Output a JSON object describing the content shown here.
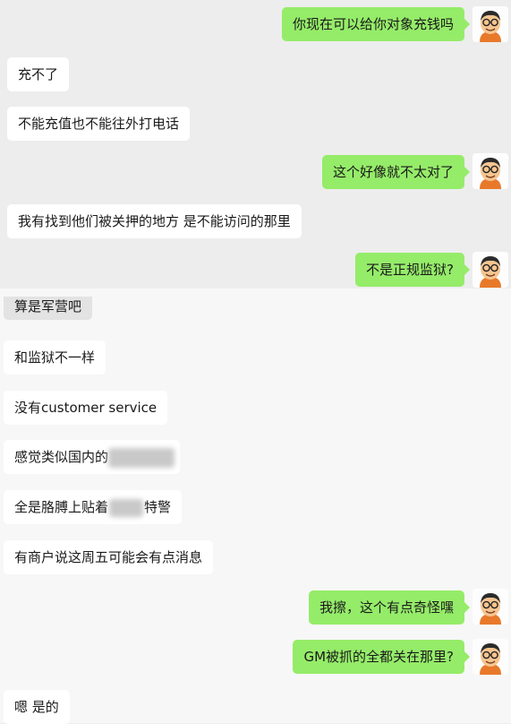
{
  "chat": {
    "messages": [
      {
        "side": "right",
        "text": "你现在可以给你对象充钱吗"
      },
      {
        "side": "left",
        "text": "充不了"
      },
      {
        "side": "left",
        "text": "不能充值也不能往外打电话"
      },
      {
        "side": "right",
        "text": "这个好像就不太对了"
      },
      {
        "side": "left",
        "text": "我有找到他们被关押的地方 是不能访问的那里"
      },
      {
        "side": "right",
        "text": "不是正规监狱?"
      },
      {
        "side": "left",
        "text": "算是军营吧"
      },
      {
        "side": "left",
        "text": "和监狱不一样"
      },
      {
        "side": "left",
        "text": "没有customer service"
      },
      {
        "side": "left",
        "text": "感觉类似国内的"
      },
      {
        "side": "left",
        "text_a": "全是胳膊上贴着",
        "text_b": "特警"
      },
      {
        "side": "left",
        "text": "有商户说这周五可能会有点消息"
      },
      {
        "side": "right",
        "text": "我擦，这个有点奇怪嘿"
      },
      {
        "side": "right",
        "text": "GM被抓的全都关在那里?"
      },
      {
        "side": "left",
        "text": "嗯 是的"
      }
    ]
  },
  "colors": {
    "sent_bubble": "#95ec69",
    "received_bubble": "#ffffff",
    "background": "#ededed"
  },
  "icons": {
    "sender_avatar": "cartoon-man-with-glasses-avatar"
  }
}
